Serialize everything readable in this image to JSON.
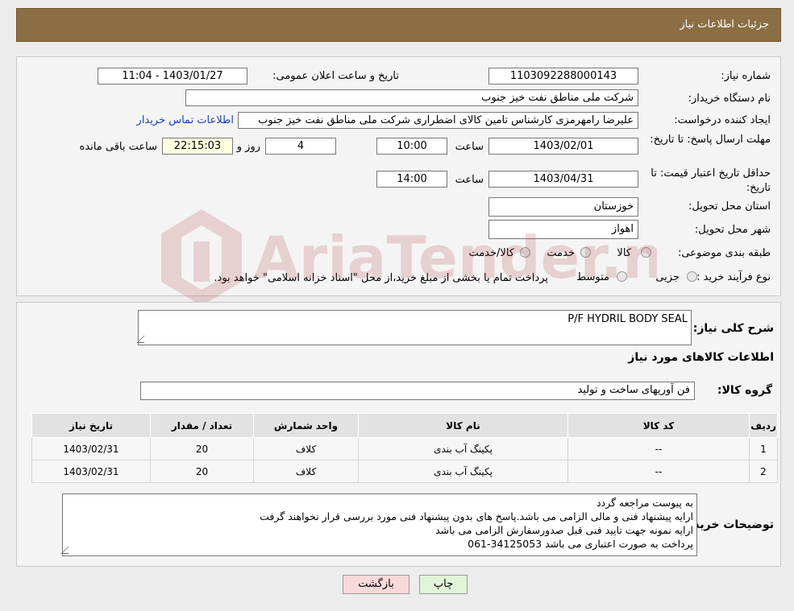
{
  "header": {
    "title": "جزئیات اطلاعات نیاز"
  },
  "form": {
    "need_number_label": "شماره نیاز:",
    "need_number": "1103092288000143",
    "announce_label": "تاریخ و ساعت اعلان عمومی:",
    "announce_value": "1403/01/27 - 11:04",
    "buyer_label": "نام دستگاه خریدار:",
    "buyer": "شرکت ملی مناطق نفت خیز جنوب",
    "creator_label": "ایجاد کننده درخواست:",
    "creator": "علیرضا رامهرمزی کارشناس تامین کالای اضطراری شرکت ملی مناطق نفت خیز جنوب",
    "contact_link": "اطلاعات تماس خریدار",
    "deadline_label": "مهلت ارسال پاسخ: تا تاریخ:",
    "deadline_date": "1403/02/01",
    "time_label": "ساعت",
    "deadline_time": "10:00",
    "days": "4",
    "days_label": "روز و",
    "remaining": "22:15:03",
    "remaining_label": "ساعت باقی مانده",
    "validity_label": "حداقل تاریخ اعتبار قیمت: تا تاریخ:",
    "validity_date": "1403/04/31",
    "validity_time": "14:00",
    "province_label": "استان محل تحویل:",
    "province": "خوزستان",
    "city_label": "شهر محل تحویل:",
    "city": "اهواز",
    "category_label": "طبقه بندی موضوعی:",
    "category_options": [
      "کالا",
      "خدمت",
      "کالا/خدمت"
    ],
    "process_label": "نوع فرآیند خرید :",
    "process_options": [
      "جزیی",
      "متوسط"
    ],
    "process_note": "پرداخت تمام یا بخشی از مبلغ خرید،از محل \"اسناد خزانه اسلامی\" خواهد بود."
  },
  "details": {
    "description_label": "شرح کلی نیاز:",
    "description": "P/F HYDRIL BODY SEAL",
    "items_title": "اطلاعات کالاهای مورد نیاز",
    "group_label": "گروه کالا:",
    "group": "فن آوریهای ساخت و تولید",
    "columns": [
      "ردیف",
      "کد کالا",
      "نام کالا",
      "واحد شمارش",
      "تعداد / مقدار",
      "تاریخ نیاز"
    ],
    "rows": [
      [
        "1",
        "--",
        "پکینگ آب بندی",
        "کلاف",
        "20",
        "1403/02/31"
      ],
      [
        "2",
        "--",
        "پکینگ آب بندی",
        "کلاف",
        "20",
        "1403/02/31"
      ]
    ],
    "notes_label": "توضیحات خریدار:",
    "notes": [
      "به پیوست مراجعه گردد",
      "ارایه پیشنهاد فنی و مالی الزامی می باشد.پاسخ های بدون پیشنهاد فنی مورد بررسی قرار نخواهند گرفت",
      "ارایه نمونه جهت تایید فنی قبل صدورسفارش الزامی می باشد",
      "پرداخت به صورت اعتباری می باشد 34125053-061"
    ]
  },
  "buttons": {
    "print": "چاپ",
    "back": "بازگشت"
  },
  "watermark": {
    "text": "AriaTender.neT"
  },
  "colors": {
    "header": "#8b6e43",
    "link": "#1a3fb8",
    "back_button": "#f9d9d9",
    "print_button": "#e2f4d8"
  }
}
